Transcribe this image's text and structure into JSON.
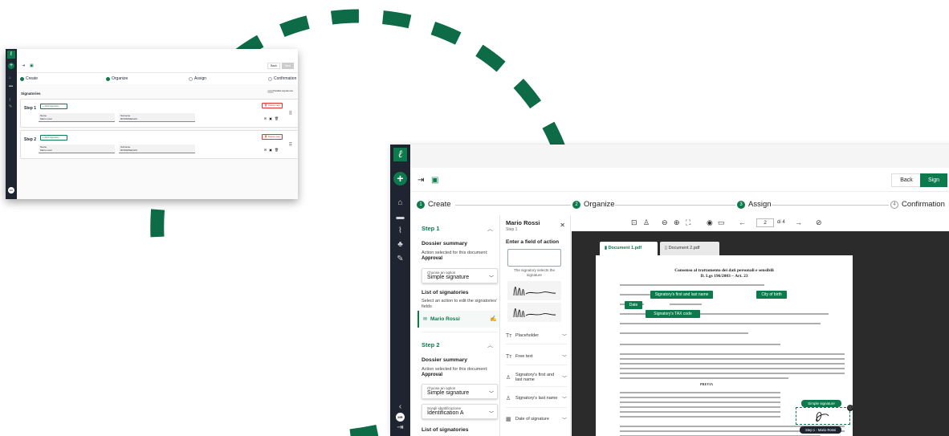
{
  "colors": {
    "brand": "#0d7a4e",
    "sidebar": "#1f2530",
    "arc": "#0d6b47",
    "danger": "#d33"
  },
  "small": {
    "toolbar": {
      "back": "Back",
      "next": "Next"
    },
    "steps": [
      "Create",
      "Organize",
      "Assign",
      "Confirmation"
    ],
    "signatories_title": "Signatories",
    "toggle_label": "Parallel signatures",
    "cards": [
      {
        "label": "Step 1",
        "add": "Add signatory",
        "remove": "Delete step",
        "f1_label": "Name",
        "f1_value": "Mario rossi",
        "f2_label": "Surname",
        "f2_value": "ROSSI/Mario01"
      },
      {
        "label": "Step 2",
        "add": "Add signatory",
        "remove": "Delete step",
        "f1_label": "Name",
        "f1_value": "Mario rossi",
        "f2_label": "Surname",
        "f2_value": "ROSSI/Mario01"
      }
    ],
    "avatar": "MR"
  },
  "large": {
    "icons": {
      "home": "home-icon",
      "folder": "folder-icon",
      "chart": "chart-icon",
      "org": "org-icon",
      "tools": "wrench-icon"
    },
    "toolbar": {
      "back": "Back",
      "sign": "Sign"
    },
    "steps": [
      {
        "n": "1",
        "label": "Create"
      },
      {
        "n": "2",
        "label": "Organize"
      },
      {
        "n": "3",
        "label": "Assign"
      },
      {
        "n": "4",
        "label": "Confirmation"
      }
    ],
    "left": {
      "step1": "Step 1",
      "dossier": "Dossier summary",
      "action_text": "Action selected for this document:",
      "action_value": "Approval",
      "choose_label": "Choose an option",
      "choose_value": "Simple signature",
      "list": "List of signatories",
      "list_hint": "Select an action to edit the signatories' fields",
      "person": "Mario Rossi",
      "step2": "Step 2",
      "dossier2": "Dossier summary",
      "action_text2": "Action selected for this document:",
      "action_value2": "Approval",
      "choose_label2": "Choose an option",
      "choose_value2": "Simple signature",
      "ident_label": "Scegli identificazione",
      "ident_value": "Identification A",
      "list2": "List of signatories",
      "avatar": "MR"
    },
    "middle": {
      "name": "Mario Rossi",
      "step": "Step 1",
      "enter": "Enter a field of action",
      "hint": "The signatory selects the signature",
      "items": [
        {
          "icon": "Tт",
          "label": "Placeholder"
        },
        {
          "icon": "Tт",
          "label": "Free text"
        },
        {
          "icon": "♙",
          "label": "Signatory's first and last name"
        },
        {
          "icon": "♙",
          "label": "Signatory's last name"
        },
        {
          "icon": "▦",
          "label": "Date of signature"
        }
      ]
    },
    "viewer": {
      "page": "2",
      "of": "di 4",
      "tab1": "Document 1.pdf",
      "tab2": "Document 2.pdf",
      "title1": "Consenso al trattamento dei dati personali e sensibili",
      "title2": "D. Lgs 196/2003 – Art. 23",
      "field_name": "Signatory's first and last name",
      "field_city": "City of birth",
      "field_date": "Date",
      "field_tax": "Signatory's TAX code",
      "simple": "Simple signature",
      "tag": "Step 1 - Mario Rossi",
      "heading": "PREVIA"
    }
  }
}
